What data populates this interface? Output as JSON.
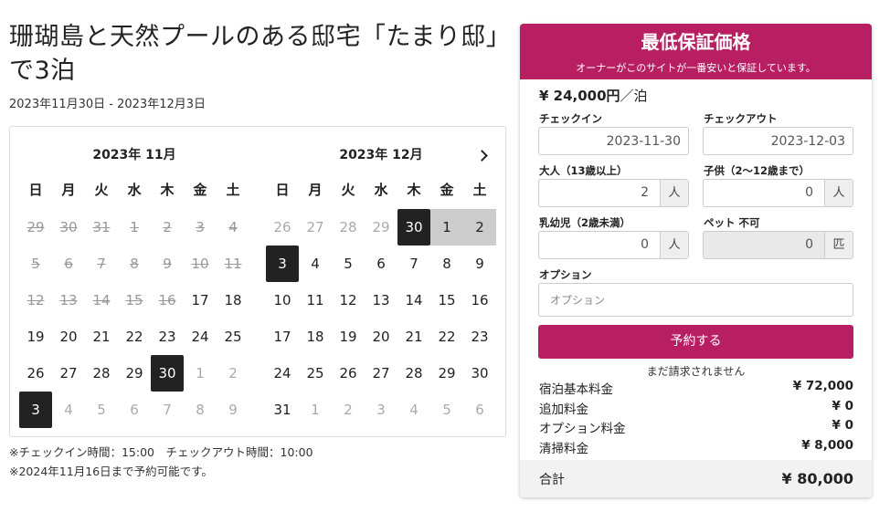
{
  "title": "珊瑚島と天然プールのある邸宅「たまり邸」で3泊",
  "date_range": "2023年11月30日 - 2023年12月3日",
  "calendar": {
    "weekdays": [
      "日",
      "月",
      "火",
      "水",
      "木",
      "金",
      "土"
    ],
    "months": [
      {
        "title": "2023年 11月",
        "days": [
          {
            "t": "29",
            "s": "past"
          },
          {
            "t": "30",
            "s": "past"
          },
          {
            "t": "31",
            "s": "past"
          },
          {
            "t": "1",
            "s": "past"
          },
          {
            "t": "2",
            "s": "past"
          },
          {
            "t": "3",
            "s": "past"
          },
          {
            "t": "4",
            "s": "past"
          },
          {
            "t": "5",
            "s": "past"
          },
          {
            "t": "6",
            "s": "past"
          },
          {
            "t": "7",
            "s": "past"
          },
          {
            "t": "8",
            "s": "past"
          },
          {
            "t": "9",
            "s": "past"
          },
          {
            "t": "10",
            "s": "past"
          },
          {
            "t": "11",
            "s": "past"
          },
          {
            "t": "12",
            "s": "past"
          },
          {
            "t": "13",
            "s": "past"
          },
          {
            "t": "14",
            "s": "past"
          },
          {
            "t": "15",
            "s": "past"
          },
          {
            "t": "16",
            "s": "past"
          },
          {
            "t": "17",
            "s": ""
          },
          {
            "t": "18",
            "s": ""
          },
          {
            "t": "19",
            "s": ""
          },
          {
            "t": "20",
            "s": ""
          },
          {
            "t": "21",
            "s": ""
          },
          {
            "t": "22",
            "s": ""
          },
          {
            "t": "23",
            "s": ""
          },
          {
            "t": "24",
            "s": ""
          },
          {
            "t": "25",
            "s": ""
          },
          {
            "t": "26",
            "s": ""
          },
          {
            "t": "27",
            "s": ""
          },
          {
            "t": "28",
            "s": ""
          },
          {
            "t": "29",
            "s": ""
          },
          {
            "t": "30",
            "s": "sel"
          },
          {
            "t": "1",
            "s": "out"
          },
          {
            "t": "2",
            "s": "out"
          },
          {
            "t": "3",
            "s": "sel"
          },
          {
            "t": "4",
            "s": "out"
          },
          {
            "t": "5",
            "s": "out"
          },
          {
            "t": "6",
            "s": "out"
          },
          {
            "t": "7",
            "s": "out"
          },
          {
            "t": "8",
            "s": "out"
          },
          {
            "t": "9",
            "s": "out"
          }
        ]
      },
      {
        "title": "2023年 12月",
        "days": [
          {
            "t": "26",
            "s": "out"
          },
          {
            "t": "27",
            "s": "out"
          },
          {
            "t": "28",
            "s": "out"
          },
          {
            "t": "29",
            "s": "out"
          },
          {
            "t": "30",
            "s": "sel"
          },
          {
            "t": "1",
            "s": "range"
          },
          {
            "t": "2",
            "s": "range"
          },
          {
            "t": "3",
            "s": "sel"
          },
          {
            "t": "4",
            "s": ""
          },
          {
            "t": "5",
            "s": ""
          },
          {
            "t": "6",
            "s": ""
          },
          {
            "t": "7",
            "s": ""
          },
          {
            "t": "8",
            "s": ""
          },
          {
            "t": "9",
            "s": ""
          },
          {
            "t": "10",
            "s": ""
          },
          {
            "t": "11",
            "s": ""
          },
          {
            "t": "12",
            "s": ""
          },
          {
            "t": "13",
            "s": ""
          },
          {
            "t": "14",
            "s": ""
          },
          {
            "t": "15",
            "s": ""
          },
          {
            "t": "16",
            "s": ""
          },
          {
            "t": "17",
            "s": ""
          },
          {
            "t": "18",
            "s": ""
          },
          {
            "t": "19",
            "s": ""
          },
          {
            "t": "20",
            "s": ""
          },
          {
            "t": "21",
            "s": ""
          },
          {
            "t": "22",
            "s": ""
          },
          {
            "t": "23",
            "s": ""
          },
          {
            "t": "24",
            "s": ""
          },
          {
            "t": "25",
            "s": ""
          },
          {
            "t": "26",
            "s": ""
          },
          {
            "t": "27",
            "s": ""
          },
          {
            "t": "28",
            "s": ""
          },
          {
            "t": "29",
            "s": ""
          },
          {
            "t": "30",
            "s": ""
          },
          {
            "t": "31",
            "s": ""
          },
          {
            "t": "1",
            "s": "out"
          },
          {
            "t": "2",
            "s": "out"
          },
          {
            "t": "3",
            "s": "out"
          },
          {
            "t": "4",
            "s": "out"
          },
          {
            "t": "5",
            "s": "out"
          },
          {
            "t": "6",
            "s": "out"
          }
        ]
      }
    ],
    "next_icon": "chevron-right-icon"
  },
  "notes": {
    "checkin_times": "※チェックイン時間：15:00　チェックアウト時間：10:00",
    "booking_deadline": "※2024年11月16日まで予約可能です。"
  },
  "booking": {
    "banner_title": "最低保証価格",
    "banner_sub": "オーナーがこのサイトが一番安いと保証しています。",
    "price": "¥ 24,000円",
    "price_unit": "／泊",
    "checkin_label": "チェックイン",
    "checkin_value": "2023-11-30",
    "checkout_label": "チェックアウト",
    "checkout_value": "2023-12-03",
    "adults_label": "大人（13歳以上）",
    "adults_value": "2",
    "adults_unit": "人",
    "children_label": "子供（2〜12歳まで）",
    "children_value": "0",
    "children_unit": "人",
    "infants_label": "乳幼児（2歳未満）",
    "infants_value": "0",
    "infants_unit": "人",
    "pets_label": "ペット 不可",
    "pets_value": "0",
    "pets_unit": "匹",
    "option_label": "オプション",
    "option_placeholder": "オプション",
    "reserve_button": "予約する",
    "not_charged": "まだ請求されません",
    "fees": [
      {
        "label": "宿泊基本料金",
        "amount": "¥ 72,000"
      },
      {
        "label": "追加料金",
        "amount": "¥ 0"
      },
      {
        "label": "オプション料金",
        "amount": "¥ 0"
      },
      {
        "label": "清掃料金",
        "amount": "¥ 8,000"
      }
    ],
    "total_label": "合計",
    "total_value": "¥ 80,000"
  },
  "colors": {
    "accent": "#b81f62",
    "selected_day": "#222222",
    "range_day": "#cccccc"
  }
}
